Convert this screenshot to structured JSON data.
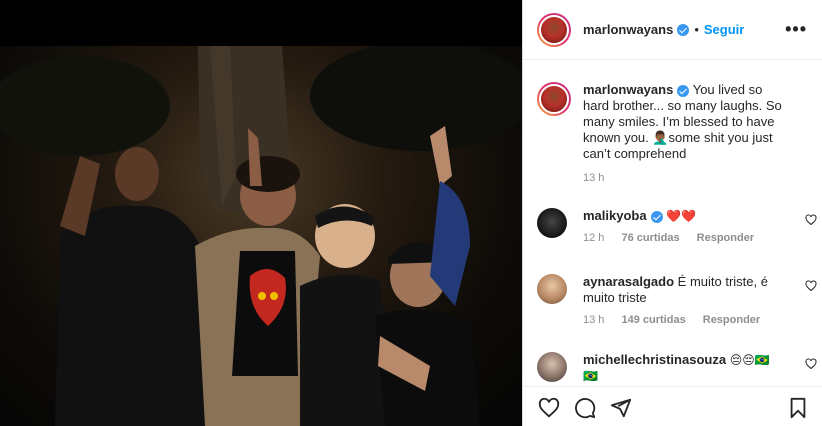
{
  "post": {
    "username": "marlonwayans",
    "follow_label": "Seguir",
    "separator": "•",
    "more_label": "•••",
    "caption_text": "You lived so hard brother... so many laughs. So many smiles. I’m blessed to have known you. 🤦🏾‍♂️some shit you just can’t comprehend",
    "caption_time": "13 h"
  },
  "comments": [
    {
      "username": "malikyoba",
      "text": "❤️❤️",
      "time": "12 h",
      "likes": "76 curtidas",
      "reply": "Responder",
      "verified": true
    },
    {
      "username": "aynarasalgado",
      "text": "É muito triste, é muito triste",
      "time": "13 h",
      "likes": "149 curtidas",
      "reply": "Responder",
      "verified": false
    },
    {
      "username": "michellechristinasouza",
      "text": "😔😔🇧🇷 🇧🇷",
      "verified": false
    }
  ],
  "colors": {
    "link_blue": "#0095f6",
    "verified_blue": "#3897f0",
    "text": "#262626",
    "muted": "#8e8e8e"
  },
  "icons": [
    "heart-icon",
    "comment-icon",
    "share-icon",
    "bookmark-icon",
    "verified-badge-icon",
    "more-options-icon"
  ]
}
